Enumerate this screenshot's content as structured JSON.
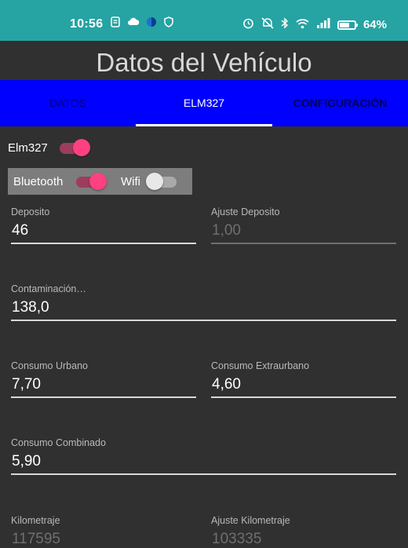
{
  "status_bar": {
    "time": "10:56",
    "battery_text": "64%",
    "battery_level": 0.64,
    "left_icons": [
      "sim-icon",
      "cloud-icon",
      "app-circle-icon",
      "shield-icon"
    ],
    "right_icons": [
      "alarm-icon",
      "mute-icon",
      "bluetooth-icon",
      "wifi-icon",
      "signal-icon",
      "battery-icon"
    ]
  },
  "app": {
    "title": "Datos del Vehículo"
  },
  "tabs": [
    {
      "label": "DATOS",
      "active": false
    },
    {
      "label": "ELM327",
      "active": true
    },
    {
      "label": "CONFIGURACIÓN",
      "active": false
    }
  ],
  "elm327": {
    "label": "Elm327",
    "enabled": true
  },
  "connection": {
    "bluetooth_label": "Bluetooth",
    "bluetooth_on": true,
    "wifi_label": "Wifi",
    "wifi_on": false
  },
  "fields": {
    "deposito": {
      "label": "Deposito",
      "value": "46"
    },
    "ajuste_deposito": {
      "label": "Ajuste Deposito",
      "value": "1,00"
    },
    "contaminacion": {
      "label": "Contaminación…",
      "value": "138,0"
    },
    "consumo_urbano": {
      "label": "Consumo Urbano",
      "value": "7,70"
    },
    "consumo_extraurbano": {
      "label": "Consumo Extraurbano",
      "value": "4,60"
    },
    "consumo_combinado": {
      "label": "Consumo Combinado",
      "value": "5,90"
    },
    "kilometraje": {
      "label": "Kilometraje",
      "value": "117595"
    },
    "ajuste_kilometraje": {
      "label": "Ajuste Kilometraje",
      "value": "103335"
    }
  },
  "colors": {
    "status_bar": "#26a3a3",
    "background": "#303030",
    "tab_bar": "#0000ff",
    "switch_accent": "#ff4081"
  }
}
